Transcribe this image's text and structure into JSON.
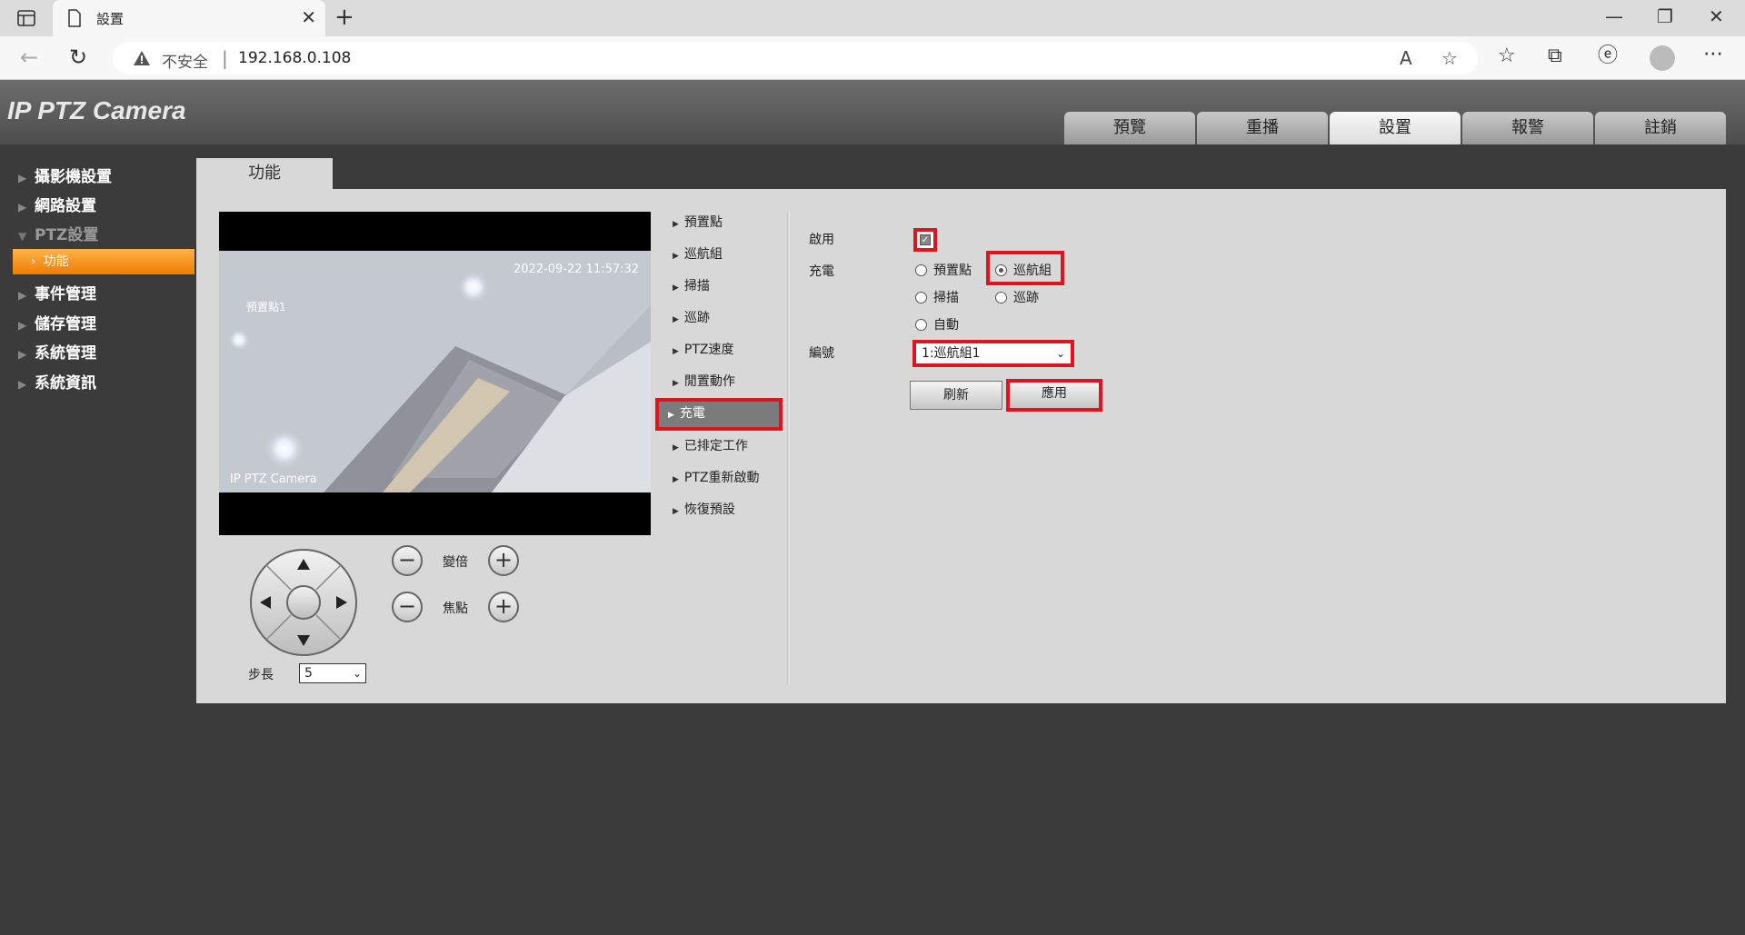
{
  "browser": {
    "tab_title": "設置",
    "url_warning": "不安全",
    "url": "192.168.0.108"
  },
  "app": {
    "logo": "IP PTZ Camera",
    "main_tabs": [
      {
        "label": "預覽"
      },
      {
        "label": "重播"
      },
      {
        "label": "設置"
      },
      {
        "label": "報警"
      },
      {
        "label": "註銷"
      }
    ]
  },
  "sidebar": {
    "items": [
      {
        "label": "攝影機設置"
      },
      {
        "label": "網路設置"
      },
      {
        "label": "PTZ設置"
      },
      {
        "label": "事件管理"
      },
      {
        "label": "儲存管理"
      },
      {
        "label": "系統管理"
      },
      {
        "label": "系統資訊"
      }
    ],
    "sub_item": "功能"
  },
  "content": {
    "tab_label": "功能",
    "video": {
      "timestamp": "2022-09-22 11:57:32",
      "preset_label": "預置點1",
      "camera_label": "IP PTZ Camera"
    },
    "zoom_label": "變倍",
    "focus_label": "焦點",
    "step_label": "步長",
    "step_value": "5",
    "menu": [
      {
        "label": "預置點"
      },
      {
        "label": "巡航組"
      },
      {
        "label": "掃描"
      },
      {
        "label": "巡跡"
      },
      {
        "label": "PTZ速度"
      },
      {
        "label": "閒置動作"
      },
      {
        "label": "充電"
      },
      {
        "label": "已排定工作"
      },
      {
        "label": "PTZ重新啟動"
      },
      {
        "label": "恢復預設"
      }
    ],
    "form": {
      "enable_label": "啟用",
      "enable_checked": true,
      "charge_label": "充電",
      "options": [
        {
          "label": "預置點",
          "selected": false
        },
        {
          "label": "巡航組",
          "selected": true
        },
        {
          "label": "掃描",
          "selected": false
        },
        {
          "label": "巡跡",
          "selected": false
        },
        {
          "label": "自動",
          "selected": false
        }
      ],
      "number_label": "編號",
      "number_value": "1:巡航組1",
      "refresh_label": "刷新",
      "apply_label": "應用"
    }
  },
  "colors": {
    "highlight_red": "#e0141e",
    "active_orange": "#f07d00"
  }
}
